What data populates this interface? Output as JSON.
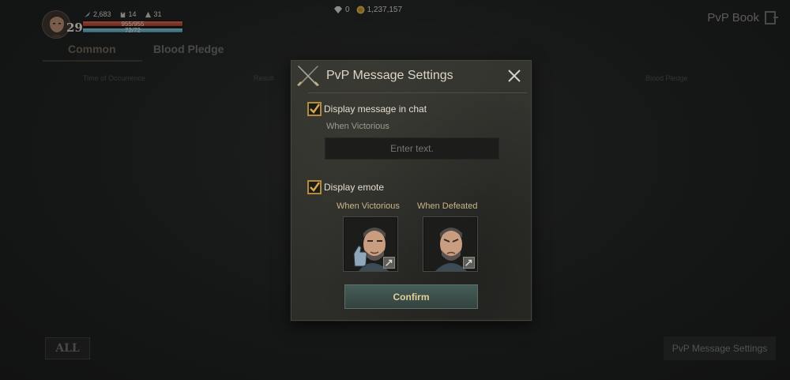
{
  "player": {
    "level": "29",
    "stat1": "2,683",
    "stat2": "14",
    "stat3": "31",
    "hp_text": "955/955",
    "mp_text": "72/72",
    "hp_fraction": 1.0,
    "mp_fraction": 1.0
  },
  "currency": {
    "diamonds": "0",
    "adena": "1,237,157"
  },
  "header": {
    "pvp_book_label": "PvP Book"
  },
  "tabs": [
    {
      "label": "Common"
    },
    {
      "label": "Blood Pledge"
    }
  ],
  "columns": {
    "time": "Time of Occurrence",
    "result": "Result",
    "pledge": "Blood Pledge"
  },
  "bottom": {
    "all_label": "ALL",
    "settings_label": "PvP Message Settings"
  },
  "modal": {
    "title": "PvP Message Settings",
    "chat_checkbox_label": "Display message in chat",
    "chat_checked": true,
    "when_victorious_label": "When Victorious",
    "message_placeholder": "Enter text.",
    "message_value": "",
    "emote_checkbox_label": "Display emote",
    "emote_checked": true,
    "emote_victorious_label": "When Victorious",
    "emote_defeated_label": "When Defeated",
    "confirm_label": "Confirm"
  },
  "colors": {
    "accent_gold": "#b48b3b",
    "confirm_bg": "#465c58",
    "hp_red": "#d8654d",
    "mp_blue": "#8bc9d8"
  }
}
